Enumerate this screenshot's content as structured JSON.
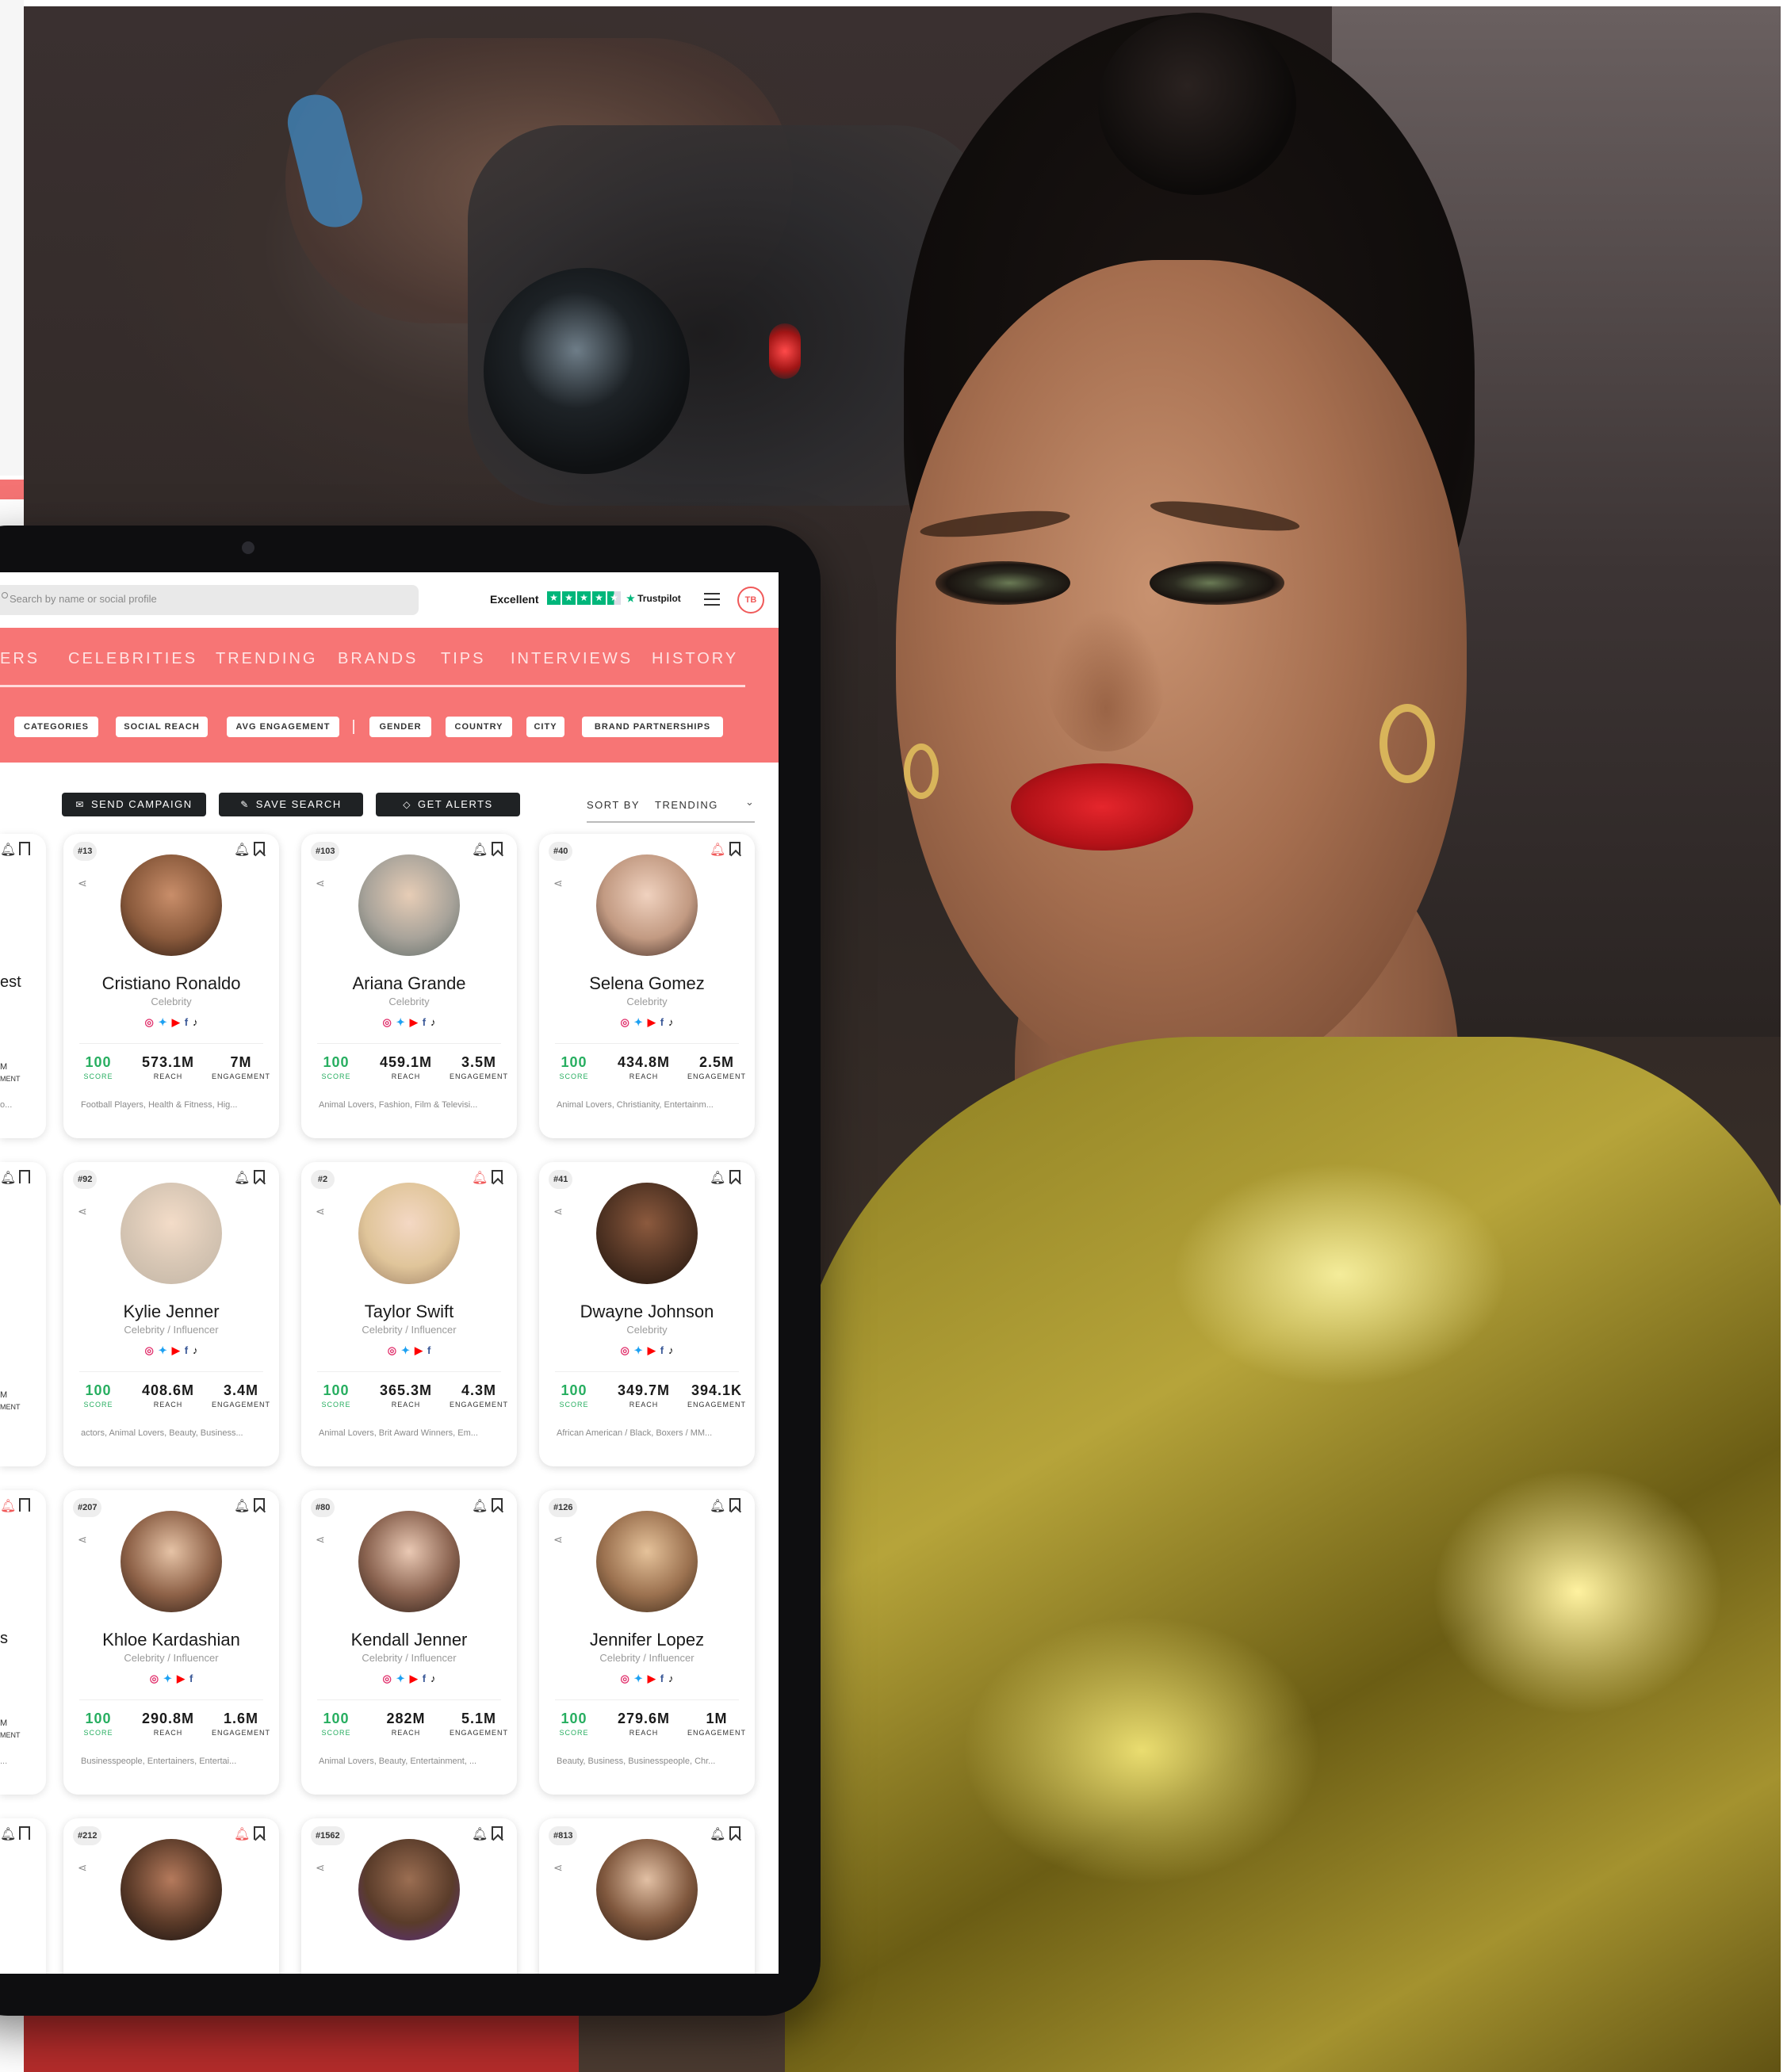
{
  "header": {
    "search_placeholder": "Search by name or social profile",
    "trustpilot_rating": "Excellent",
    "trustpilot_label": "Trustpilot",
    "avatar_initials": "TB"
  },
  "nav": {
    "tabs": [
      "ERS",
      "CELEBRITIES",
      "TRENDING",
      "BRANDS",
      "TIPS",
      "INTERVIEWS",
      "HISTORY"
    ]
  },
  "filters": [
    "CATEGORIES",
    "SOCIAL REACH",
    "AVG ENGAGEMENT",
    "GENDER",
    "COUNTRY",
    "CITY",
    "BRAND PARTNERSHIPS"
  ],
  "actions": {
    "send_campaign": "SEND CAMPAIGN",
    "save_search": "SAVE SEARCH",
    "get_alerts": "GET ALERTS",
    "sort_label": "SORT BY",
    "sort_value": "TRENDING"
  },
  "stat_labels": {
    "score": "SCORE",
    "reach": "REACH",
    "engagement": "ENGAGEMENT"
  },
  "cards": [
    {
      "rank": "#13",
      "name": "Cristiano Ronaldo",
      "role": "Celebrity",
      "score": "100",
      "reach": "573.1M",
      "engagement": "7M",
      "tags": "Football Players, Health & Fitness, Hig...",
      "socials": [
        "ig",
        "tw",
        "yt",
        "fb",
        "tt"
      ],
      "bell_active": false
    },
    {
      "rank": "#103",
      "name": "Ariana Grande",
      "role": "Celebrity",
      "score": "100",
      "reach": "459.1M",
      "engagement": "3.5M",
      "tags": "Animal Lovers, Fashion, Film & Televisi...",
      "socials": [
        "ig",
        "tw",
        "yt",
        "fb",
        "tt"
      ],
      "bell_active": false
    },
    {
      "rank": "#40",
      "name": "Selena Gomez",
      "role": "Celebrity",
      "score": "100",
      "reach": "434.8M",
      "engagement": "2.5M",
      "tags": "Animal Lovers, Christianity, Entertainm...",
      "socials": [
        "ig",
        "tw",
        "yt",
        "fb",
        "tt"
      ],
      "bell_active": true
    },
    {
      "rank": "#92",
      "name": "Kylie Jenner",
      "role": "Celebrity / Influencer",
      "score": "100",
      "reach": "408.6M",
      "engagement": "3.4M",
      "tags": "actors, Animal Lovers, Beauty, Business...",
      "socials": [
        "ig",
        "tw",
        "yt",
        "fb",
        "tt"
      ],
      "bell_active": false
    },
    {
      "rank": "#2",
      "name": "Taylor Swift",
      "role": "Celebrity / Influencer",
      "score": "100",
      "reach": "365.3M",
      "engagement": "4.3M",
      "tags": "Animal Lovers, Brit Award Winners, Em...",
      "socials": [
        "ig",
        "tw",
        "yt",
        "fb"
      ],
      "bell_active": true
    },
    {
      "rank": "#41",
      "name": "Dwayne Johnson",
      "role": "Celebrity",
      "score": "100",
      "reach": "349.7M",
      "engagement": "394.1K",
      "tags": "African American / Black, Boxers / MM...",
      "socials": [
        "ig",
        "tw",
        "yt",
        "fb",
        "tt"
      ],
      "bell_active": false
    },
    {
      "rank": "#207",
      "name": "Khloe Kardashian",
      "role": "Celebrity / Influencer",
      "score": "100",
      "reach": "290.8M",
      "engagement": "1.6M",
      "tags": "Businesspeople, Entertainers, Entertai...",
      "socials": [
        "ig",
        "tw",
        "yt",
        "fb"
      ],
      "bell_active": false
    },
    {
      "rank": "#80",
      "name": "Kendall Jenner",
      "role": "Celebrity / Influencer",
      "score": "100",
      "reach": "282M",
      "engagement": "5.1M",
      "tags": "Animal Lovers, Beauty, Entertainment, ...",
      "socials": [
        "ig",
        "tw",
        "yt",
        "fb",
        "tt"
      ],
      "bell_active": false
    },
    {
      "rank": "#126",
      "name": "Jennifer Lopez",
      "role": "Celebrity / Influencer",
      "score": "100",
      "reach": "279.6M",
      "engagement": "1M",
      "tags": "Beauty, Business, Businesspeople, Chr...",
      "socials": [
        "ig",
        "tw",
        "yt",
        "fb",
        "tt"
      ],
      "bell_active": false
    },
    {
      "rank": "#212",
      "name": "",
      "role": "",
      "score": "",
      "reach": "",
      "engagement": "",
      "tags": "",
      "socials": [],
      "bell_active": true
    },
    {
      "rank": "#1562",
      "name": "",
      "role": "",
      "score": "",
      "reach": "",
      "engagement": "",
      "tags": "",
      "socials": [],
      "bell_active": false
    },
    {
      "rank": "#813",
      "name": "",
      "role": "",
      "score": "",
      "reach": "",
      "engagement": "",
      "tags": "",
      "socials": [],
      "bell_active": false
    }
  ],
  "partial_cards": [
    {
      "text": "est",
      "stat": "M",
      "sub": "MENT",
      "tag": "o..."
    },
    {
      "text": "",
      "stat": "M",
      "sub": "MENT",
      "tag": ""
    },
    {
      "text": "s",
      "stat": "M",
      "sub": "MENT",
      "tag": "..."
    },
    {
      "text": "",
      "stat": "",
      "sub": "",
      "tag": ""
    }
  ],
  "colors": {
    "brand_coral": "#f77575",
    "score_green": "#27ae60",
    "trustpilot_green": "#00b67a"
  }
}
